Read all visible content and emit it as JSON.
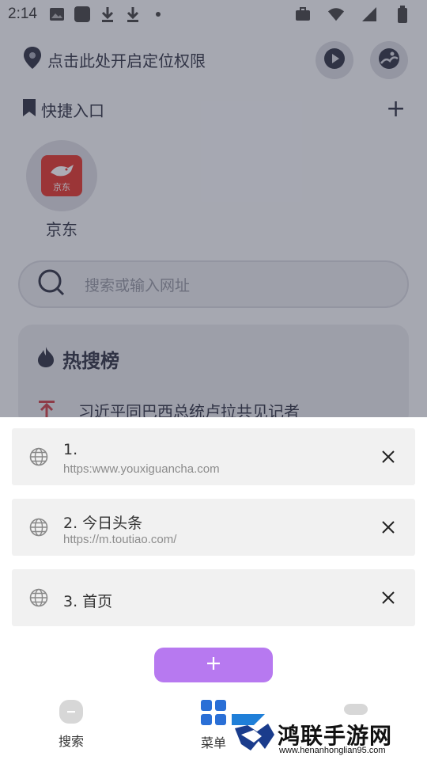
{
  "status_bar": {
    "time": "2:14",
    "icons": [
      "image-icon",
      "app-square-icon",
      "download-icon",
      "download-icon",
      "dot-icon",
      "briefcase-icon",
      "wifi-icon",
      "signal-icon",
      "battery-icon"
    ]
  },
  "location": {
    "text": "点击此处开启定位权限"
  },
  "top_buttons": [
    "play-icon",
    "avatar-icon"
  ],
  "quick_access": {
    "title": "快捷入口",
    "add_symbol": "+",
    "items": [
      {
        "label": "京东",
        "logo_text": "京东"
      }
    ]
  },
  "search": {
    "placeholder": "搜索或输入网址"
  },
  "hot_search": {
    "title": "热搜榜",
    "first_item": "习近平同巴西总统卢拉共见记者"
  },
  "tabs": [
    {
      "title": "1.",
      "url": "https:www.youxiguancha.com"
    },
    {
      "title": "2. 今日头条",
      "url": "https://m.toutiao.com/"
    },
    {
      "title": "3. 首页",
      "url": ""
    }
  ],
  "add_button": {
    "symbol": "+"
  },
  "bottom_nav": {
    "search_label": "搜索",
    "menu_label": "菜单"
  },
  "watermark": {
    "text": "鸿联手游网",
    "url": "www.henanhonglian95.com"
  },
  "colors": {
    "accent": "#b779f0",
    "jd_red": "#e1251b",
    "overlay": "#5a5e70"
  }
}
